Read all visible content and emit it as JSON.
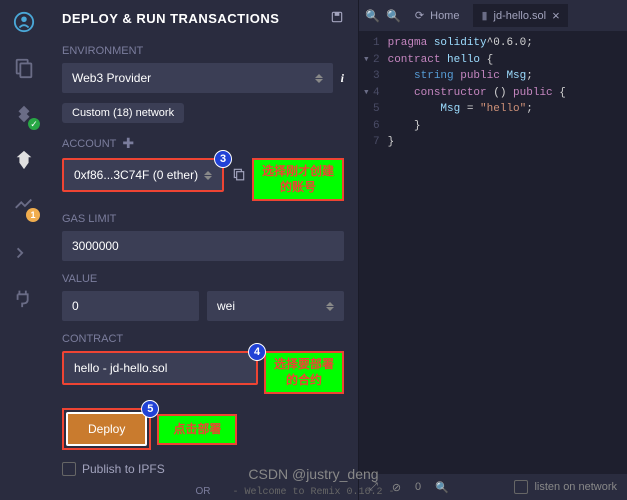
{
  "sidebar": {
    "badge_orange": "1"
  },
  "panel": {
    "title": "DEPLOY & RUN TRANSACTIONS",
    "environment_label": "ENVIRONMENT",
    "environment_value": "Web3 Provider",
    "network_pill": "Custom (18) network",
    "account_label": "ACCOUNT",
    "account_value": "0xf86...3C74F (0 ether)",
    "account_badge": "3",
    "gas_label": "GAS LIMIT",
    "gas_value": "3000000",
    "value_label": "VALUE",
    "value_amount": "0",
    "value_unit": "wei",
    "contract_label": "CONTRACT",
    "contract_value": "hello - jd-hello.sol",
    "contract_badge": "4",
    "deploy_label": "Deploy",
    "deploy_badge": "5",
    "publish_label": "Publish to IPFS",
    "or_text": "OR"
  },
  "annotations": {
    "account": "选择刚才创建的账号",
    "contract": "选择要部署的合约",
    "deploy": "点击部署"
  },
  "editor": {
    "home_tab": "Home",
    "file_tab": "jd-hello.sol",
    "code_lines": [
      {
        "n": "1",
        "t": "pragma solidity^0.6.0;"
      },
      {
        "n": "2",
        "t": "contract hello {"
      },
      {
        "n": "3",
        "t": "    string public Msg;"
      },
      {
        "n": "4",
        "t": "    constructor () public {"
      },
      {
        "n": "5",
        "t": "        Msg = \"hello\";"
      },
      {
        "n": "6",
        "t": "    }"
      },
      {
        "n": "7",
        "t": "}"
      }
    ]
  },
  "status": {
    "errors": "0",
    "listen": "listen on network"
  },
  "watermark": "CSDN @justry_deng",
  "welcome": "- Welcome to Remix 0.16.2 -"
}
